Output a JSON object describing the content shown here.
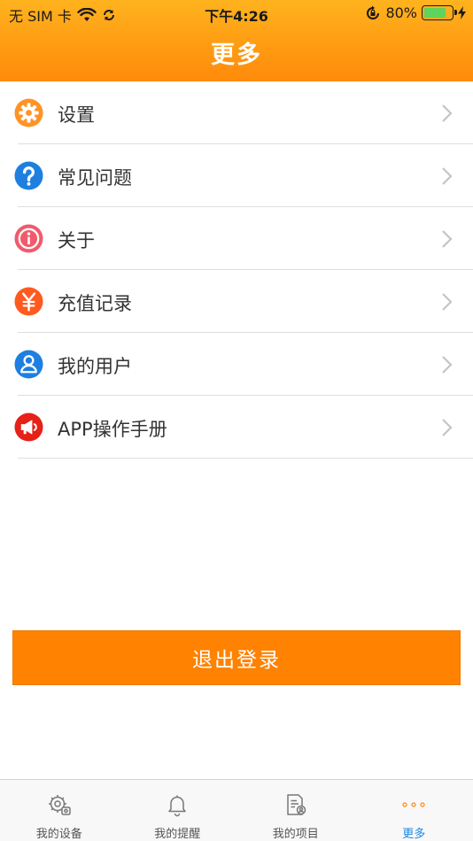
{
  "status_bar": {
    "carrier": "无 SIM 卡",
    "time": "下午4:26",
    "battery": "80%",
    "battery_level": 0.8
  },
  "header": {
    "title": "更多"
  },
  "menu": {
    "items": [
      {
        "label": "设置",
        "icon": "gear-icon",
        "color": "#ff9326"
      },
      {
        "label": "常见问题",
        "icon": "question-icon",
        "color": "#1e7fe0"
      },
      {
        "label": "关于",
        "icon": "info-icon",
        "color": "#f25a6b"
      },
      {
        "label": "充值记录",
        "icon": "yen-icon",
        "color": "#ff5a1f"
      },
      {
        "label": "我的用户",
        "icon": "user-icon",
        "color": "#1e7fe0"
      },
      {
        "label": "APP操作手册",
        "icon": "megaphone-icon",
        "color": "#e62117"
      }
    ]
  },
  "logout": {
    "label": "退出登录",
    "color": "#ff8200"
  },
  "tab_bar": {
    "tabs": [
      {
        "label": "我的设备",
        "icon": "device-settings-icon",
        "active": false
      },
      {
        "label": "我的提醒",
        "icon": "bell-icon",
        "active": false
      },
      {
        "label": "我的项目",
        "icon": "project-doc-icon",
        "active": false
      },
      {
        "label": "更多",
        "icon": "more-dots-icon",
        "active": true
      }
    ]
  }
}
